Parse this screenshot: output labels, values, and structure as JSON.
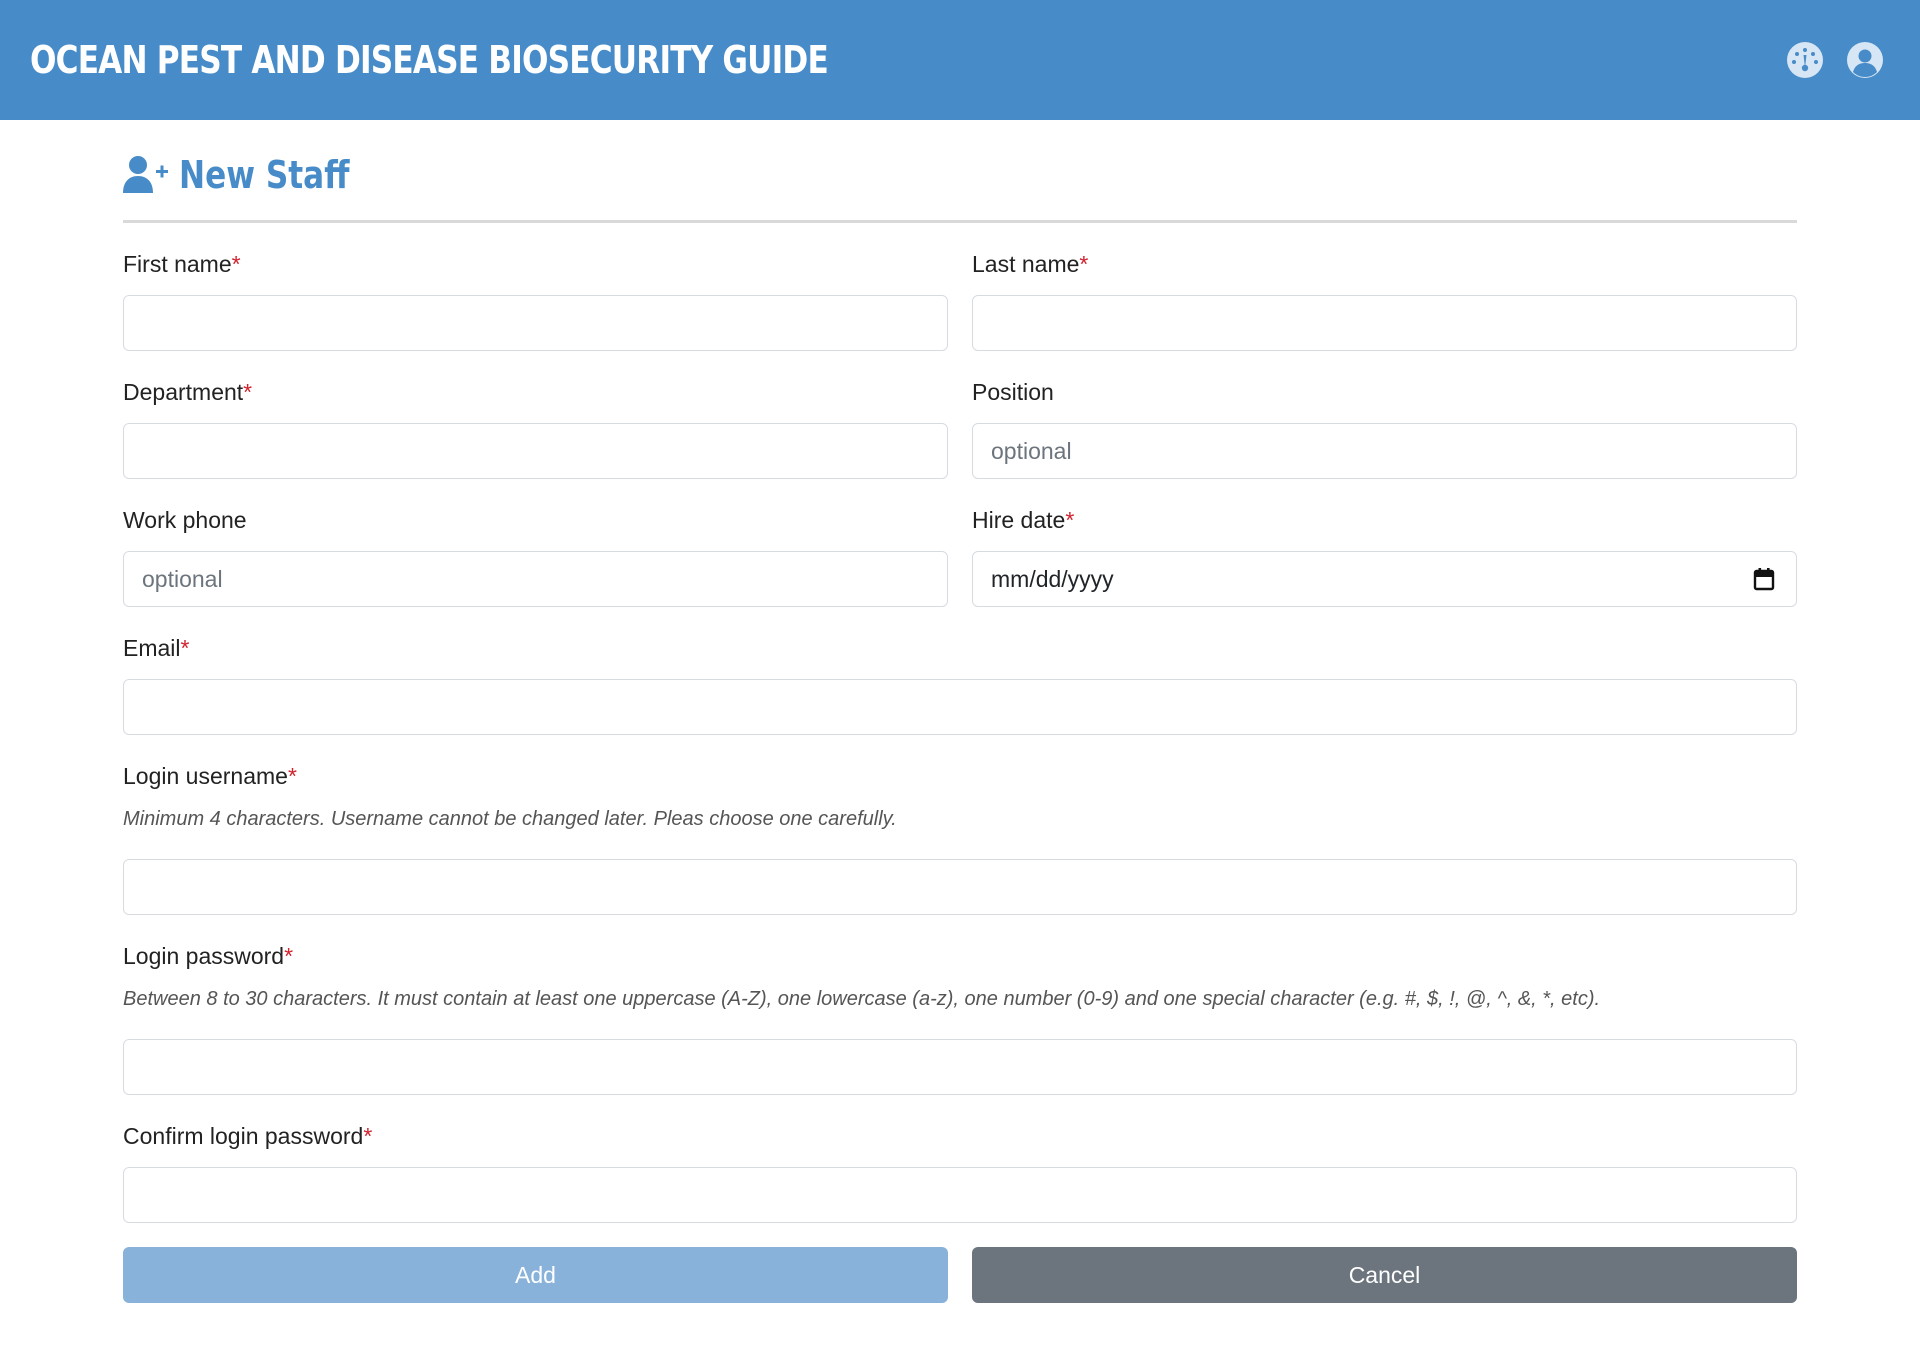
{
  "app": {
    "title": "OCEAN PEST AND DISEASE BIOSECURITY GUIDE",
    "icons": [
      "dashboard-icon",
      "user-account-icon"
    ]
  },
  "page": {
    "title": "New Staff",
    "icon": "user-plus-icon"
  },
  "colors": {
    "header": "#478cc8",
    "required": "#d0232f",
    "add_button": "#88b2da",
    "cancel_button": "#6c757d"
  },
  "form": {
    "required_marker": "*",
    "first_name": {
      "label": "First name",
      "value": ""
    },
    "last_name": {
      "label": "Last name",
      "value": ""
    },
    "department": {
      "label": "Department",
      "value": ""
    },
    "position": {
      "label": "Position",
      "placeholder": "optional"
    },
    "work_phone": {
      "label": "Work phone",
      "placeholder": "optional"
    },
    "hire_date": {
      "label": "Hire date",
      "value": "mm/dd/yyyy"
    },
    "email": {
      "label": "Email",
      "value": ""
    },
    "username": {
      "label": "Login username",
      "hint": "Minimum 4 characters. Username cannot be changed later. Pleas choose one carefully."
    },
    "password": {
      "label": "Login password",
      "hint": "Between 8 to 30 characters. It must contain at least one uppercase (A-Z), one lowercase (a-z), one number (0-9) and one special character (e.g. #, $, !, @, ^, &, *, etc)."
    },
    "confirm_password": {
      "label": "Confirm login password"
    }
  },
  "buttons": {
    "add": "Add",
    "cancel": "Cancel"
  }
}
